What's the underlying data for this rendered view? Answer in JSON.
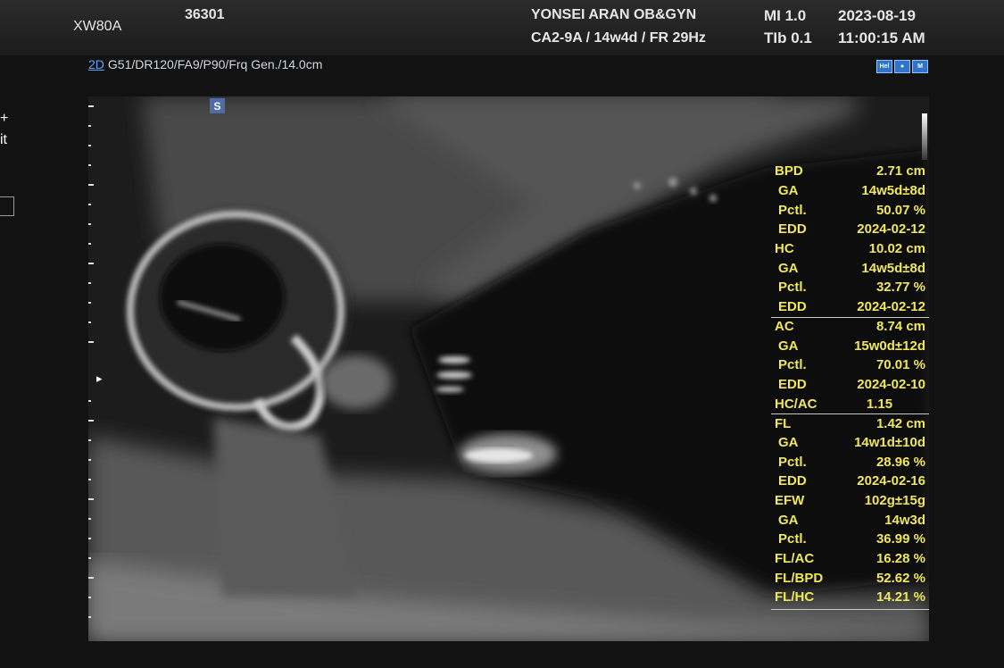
{
  "header": {
    "model": "XW80A",
    "patient_id": "36301",
    "institution": "YONSEI ARAN OB&GYN",
    "probe_info": "CA2-9A / 14w4d / FR 29Hz",
    "mi": "MI  1.0",
    "tib": "TIb 0.1",
    "date": "2023-08-19",
    "time": "11:00:15 AM"
  },
  "params": {
    "mode": "2D",
    "settings": "G51/DR120/FA9/P90/Frq Gen./14.0cm"
  },
  "toolbar_icons": [
    {
      "name": "hd-icon",
      "label": "Hel"
    },
    {
      "name": "fetus-icon",
      "label": "●"
    },
    {
      "name": "body-icon",
      "label": "M"
    }
  ],
  "left_panel": {
    "plus": "+",
    "text": "it"
  },
  "image": {
    "s_marker": "S",
    "focus_marker": "▸"
  },
  "measurements": [
    {
      "label": "BPD",
      "value": "2.71 cm",
      "sub": false
    },
    {
      "label": "GA",
      "value": "14w5d±8d",
      "sub": true
    },
    {
      "label": "Pctl.",
      "value": "50.07 %",
      "sub": true
    },
    {
      "label": "EDD",
      "value": "2024-02-12",
      "sub": true
    },
    {
      "label": "HC",
      "value": "10.02 cm",
      "sub": false
    },
    {
      "label": "GA",
      "value": "14w5d±8d",
      "sub": true
    },
    {
      "label": "Pctl.",
      "value": "32.77 %",
      "sub": true
    },
    {
      "label": "EDD",
      "value": "2024-02-12",
      "sub": true
    },
    {
      "label": "AC",
      "value": "8.74 cm",
      "sub": false
    },
    {
      "label": "GA",
      "value": "15w0d±12d",
      "sub": true
    },
    {
      "label": "Pctl.",
      "value": "70.01 %",
      "sub": true
    },
    {
      "label": "EDD",
      "value": "2024-02-10",
      "sub": true
    },
    {
      "label": "HC/AC",
      "value": "1.15",
      "sub": false
    },
    {
      "label": "FL",
      "value": "1.42 cm",
      "sub": false
    },
    {
      "label": "GA",
      "value": "14w1d±10d",
      "sub": true
    },
    {
      "label": "Pctl.",
      "value": "28.96 %",
      "sub": true
    },
    {
      "label": "EDD",
      "value": "2024-02-16",
      "sub": true
    },
    {
      "label": "EFW",
      "value": "102g±15g",
      "sub": false
    },
    {
      "label": "GA",
      "value": "14w3d",
      "sub": true
    },
    {
      "label": "Pctl.",
      "value": "36.99 %",
      "sub": true
    },
    {
      "label": "FL/AC",
      "value": "16.28 %",
      "sub": false
    },
    {
      "label": "FL/BPD",
      "value": "52.62 %",
      "sub": false
    },
    {
      "label": "FL/HC",
      "value": "14.21 %",
      "sub": false
    }
  ],
  "colors": {
    "measurement_text": "#f0e85a",
    "mode_accent": "#5ea2ff",
    "background": "#121212"
  }
}
